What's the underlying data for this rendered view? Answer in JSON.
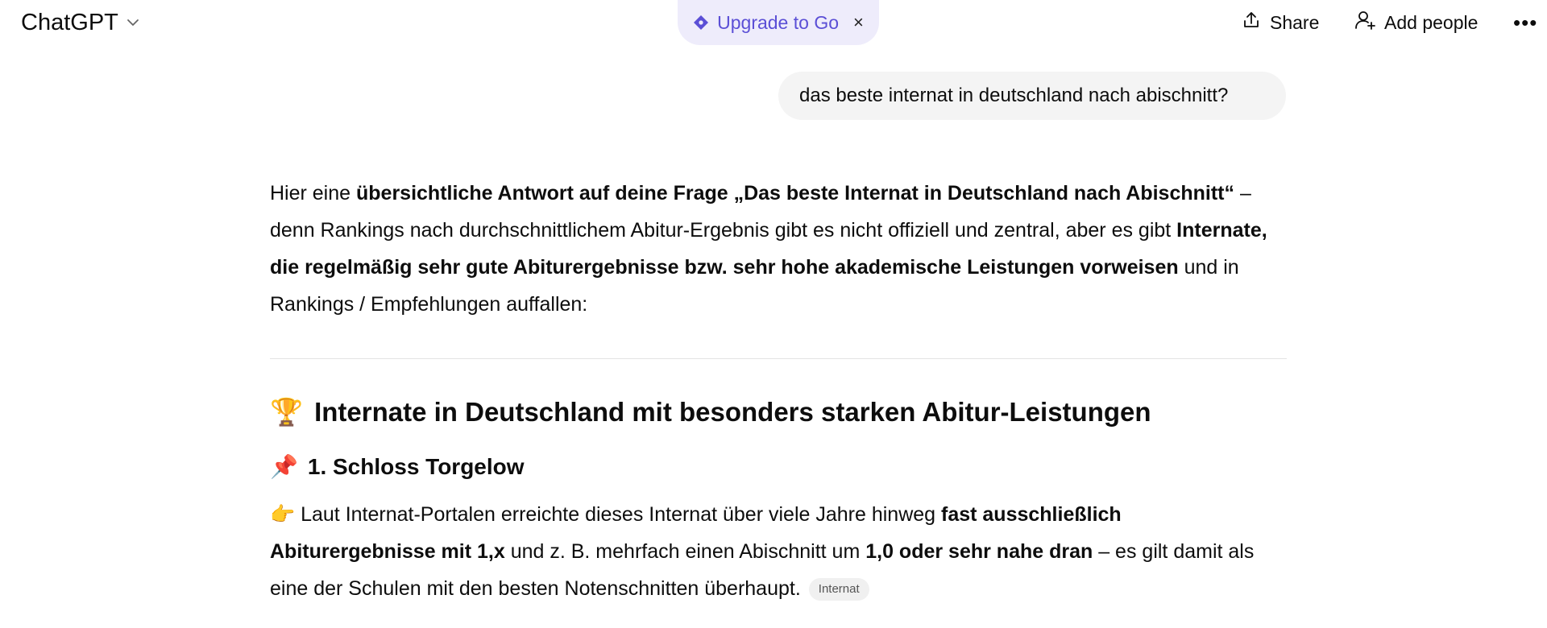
{
  "header": {
    "app_title": "ChatGPT",
    "upgrade_label": "Upgrade to Go",
    "upgrade_close": "×",
    "share_label": "Share",
    "add_people_label": "Add people",
    "more_label": "•••"
  },
  "conversation": {
    "user_message": "das beste internat in deutschland nach abischnitt?",
    "intro": {
      "t1": "Hier eine ",
      "b1": "übersichtliche Antwort auf deine Frage „Das beste Internat in Deutschland nach Abischnitt“",
      "t2": " – denn Rankings nach durchschnittlichem Abitur-Ergebnis gibt es nicht offiziell und zentral, aber es gibt ",
      "b2": "Internate, die regelmäßig sehr gute Abiturergebnisse bzw. sehr hohe akademische Leistungen vorweisen",
      "t3": " und in Rankings / Empfehlungen auffallen:"
    },
    "section_emoji": "🏆",
    "section_title": "Internate in Deutschland mit besonders starken Abitur-Leistungen",
    "item_emoji": "📌",
    "item_title": "1. Schloss Torgelow",
    "item_text": {
      "emoji": "👉",
      "t1": " Laut Internat-Portalen erreichte dieses Internat über viele Jahre hinweg ",
      "b1": "fast ausschließlich Abiturergebnisse mit 1,x",
      "t2": " und z. B. mehrfach einen Abischnitt um ",
      "b2": "1,0 oder sehr nahe dran",
      "t3": " – es gilt damit als eine der Schulen mit den besten Notenschnitten überhaupt.",
      "source_chip": "Internat"
    }
  },
  "colors": {
    "accent": "#5b4fd6",
    "upgrade_bg": "#eeecfb",
    "bubble_bg": "#f4f4f4"
  }
}
